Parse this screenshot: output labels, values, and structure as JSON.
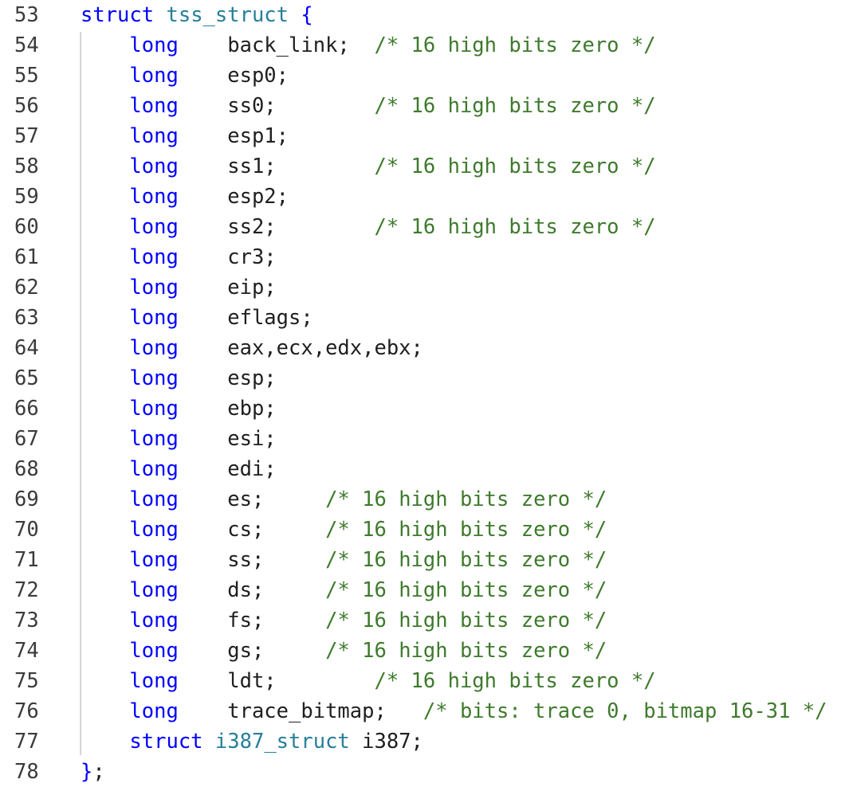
{
  "editor": {
    "lines": [
      {
        "n": "53",
        "tokens": [
          {
            "t": "struct",
            "c": "kw"
          },
          {
            "t": " ",
            "c": ""
          },
          {
            "t": "tss_struct",
            "c": "ty"
          },
          {
            "t": " {",
            "c": "kw"
          }
        ]
      },
      {
        "n": "54",
        "tokens": [
          {
            "t": "    ",
            "c": ""
          },
          {
            "t": "long",
            "c": "kw"
          },
          {
            "t": "    back_link;  ",
            "c": ""
          },
          {
            "t": "/* 16 high bits zero */",
            "c": "cm"
          }
        ]
      },
      {
        "n": "55",
        "tokens": [
          {
            "t": "    ",
            "c": ""
          },
          {
            "t": "long",
            "c": "kw"
          },
          {
            "t": "    esp0;",
            "c": ""
          }
        ]
      },
      {
        "n": "56",
        "tokens": [
          {
            "t": "    ",
            "c": ""
          },
          {
            "t": "long",
            "c": "kw"
          },
          {
            "t": "    ss0;        ",
            "c": ""
          },
          {
            "t": "/* 16 high bits zero */",
            "c": "cm"
          }
        ]
      },
      {
        "n": "57",
        "tokens": [
          {
            "t": "    ",
            "c": ""
          },
          {
            "t": "long",
            "c": "kw"
          },
          {
            "t": "    esp1;",
            "c": ""
          }
        ]
      },
      {
        "n": "58",
        "tokens": [
          {
            "t": "    ",
            "c": ""
          },
          {
            "t": "long",
            "c": "kw"
          },
          {
            "t": "    ss1;        ",
            "c": ""
          },
          {
            "t": "/* 16 high bits zero */",
            "c": "cm"
          }
        ]
      },
      {
        "n": "59",
        "tokens": [
          {
            "t": "    ",
            "c": ""
          },
          {
            "t": "long",
            "c": "kw"
          },
          {
            "t": "    esp2;",
            "c": ""
          }
        ]
      },
      {
        "n": "60",
        "tokens": [
          {
            "t": "    ",
            "c": ""
          },
          {
            "t": "long",
            "c": "kw"
          },
          {
            "t": "    ss2;        ",
            "c": ""
          },
          {
            "t": "/* 16 high bits zero */",
            "c": "cm"
          }
        ]
      },
      {
        "n": "61",
        "tokens": [
          {
            "t": "    ",
            "c": ""
          },
          {
            "t": "long",
            "c": "kw"
          },
          {
            "t": "    cr3;",
            "c": ""
          }
        ]
      },
      {
        "n": "62",
        "tokens": [
          {
            "t": "    ",
            "c": ""
          },
          {
            "t": "long",
            "c": "kw"
          },
          {
            "t": "    eip;",
            "c": ""
          }
        ]
      },
      {
        "n": "63",
        "tokens": [
          {
            "t": "    ",
            "c": ""
          },
          {
            "t": "long",
            "c": "kw"
          },
          {
            "t": "    eflags;",
            "c": ""
          }
        ]
      },
      {
        "n": "64",
        "tokens": [
          {
            "t": "    ",
            "c": ""
          },
          {
            "t": "long",
            "c": "kw"
          },
          {
            "t": "    eax,ecx,edx,ebx;",
            "c": ""
          }
        ]
      },
      {
        "n": "65",
        "tokens": [
          {
            "t": "    ",
            "c": ""
          },
          {
            "t": "long",
            "c": "kw"
          },
          {
            "t": "    esp;",
            "c": ""
          }
        ]
      },
      {
        "n": "66",
        "tokens": [
          {
            "t": "    ",
            "c": ""
          },
          {
            "t": "long",
            "c": "kw"
          },
          {
            "t": "    ebp;",
            "c": ""
          }
        ]
      },
      {
        "n": "67",
        "tokens": [
          {
            "t": "    ",
            "c": ""
          },
          {
            "t": "long",
            "c": "kw"
          },
          {
            "t": "    esi;",
            "c": ""
          }
        ]
      },
      {
        "n": "68",
        "tokens": [
          {
            "t": "    ",
            "c": ""
          },
          {
            "t": "long",
            "c": "kw"
          },
          {
            "t": "    edi;",
            "c": ""
          }
        ]
      },
      {
        "n": "69",
        "tokens": [
          {
            "t": "    ",
            "c": ""
          },
          {
            "t": "long",
            "c": "kw"
          },
          {
            "t": "    es;     ",
            "c": ""
          },
          {
            "t": "/* 16 high bits zero */",
            "c": "cm"
          }
        ]
      },
      {
        "n": "70",
        "tokens": [
          {
            "t": "    ",
            "c": ""
          },
          {
            "t": "long",
            "c": "kw"
          },
          {
            "t": "    cs;     ",
            "c": ""
          },
          {
            "t": "/* 16 high bits zero */",
            "c": "cm"
          }
        ]
      },
      {
        "n": "71",
        "tokens": [
          {
            "t": "    ",
            "c": ""
          },
          {
            "t": "long",
            "c": "kw"
          },
          {
            "t": "    ss;     ",
            "c": ""
          },
          {
            "t": "/* 16 high bits zero */",
            "c": "cm"
          }
        ]
      },
      {
        "n": "72",
        "tokens": [
          {
            "t": "    ",
            "c": ""
          },
          {
            "t": "long",
            "c": "kw"
          },
          {
            "t": "    ds;     ",
            "c": ""
          },
          {
            "t": "/* 16 high bits zero */",
            "c": "cm"
          }
        ]
      },
      {
        "n": "73",
        "tokens": [
          {
            "t": "    ",
            "c": ""
          },
          {
            "t": "long",
            "c": "kw"
          },
          {
            "t": "    fs;     ",
            "c": ""
          },
          {
            "t": "/* 16 high bits zero */",
            "c": "cm"
          }
        ]
      },
      {
        "n": "74",
        "tokens": [
          {
            "t": "    ",
            "c": ""
          },
          {
            "t": "long",
            "c": "kw"
          },
          {
            "t": "    gs;     ",
            "c": ""
          },
          {
            "t": "/* 16 high bits zero */",
            "c": "cm"
          }
        ]
      },
      {
        "n": "75",
        "tokens": [
          {
            "t": "    ",
            "c": ""
          },
          {
            "t": "long",
            "c": "kw"
          },
          {
            "t": "    ldt;        ",
            "c": ""
          },
          {
            "t": "/* 16 high bits zero */",
            "c": "cm"
          }
        ]
      },
      {
        "n": "76",
        "tokens": [
          {
            "t": "    ",
            "c": ""
          },
          {
            "t": "long",
            "c": "kw"
          },
          {
            "t": "    trace_bitmap;   ",
            "c": ""
          },
          {
            "t": "/* bits: trace 0, bitmap 16-31 */",
            "c": "cm"
          }
        ]
      },
      {
        "n": "77",
        "tokens": [
          {
            "t": "    ",
            "c": ""
          },
          {
            "t": "struct",
            "c": "kw"
          },
          {
            "t": " ",
            "c": ""
          },
          {
            "t": "i387_struct",
            "c": "ty"
          },
          {
            "t": " i387;",
            "c": ""
          }
        ]
      },
      {
        "n": "78",
        "tokens": [
          {
            "t": "}",
            "c": "kw"
          },
          {
            "t": ";",
            "c": ""
          }
        ]
      }
    ]
  },
  "colors": {
    "keyword": "#0000ff",
    "type": "#267f99",
    "comment": "#3e7a2c",
    "text": "#1f1f1f",
    "line_number": "#3b3b3b"
  }
}
